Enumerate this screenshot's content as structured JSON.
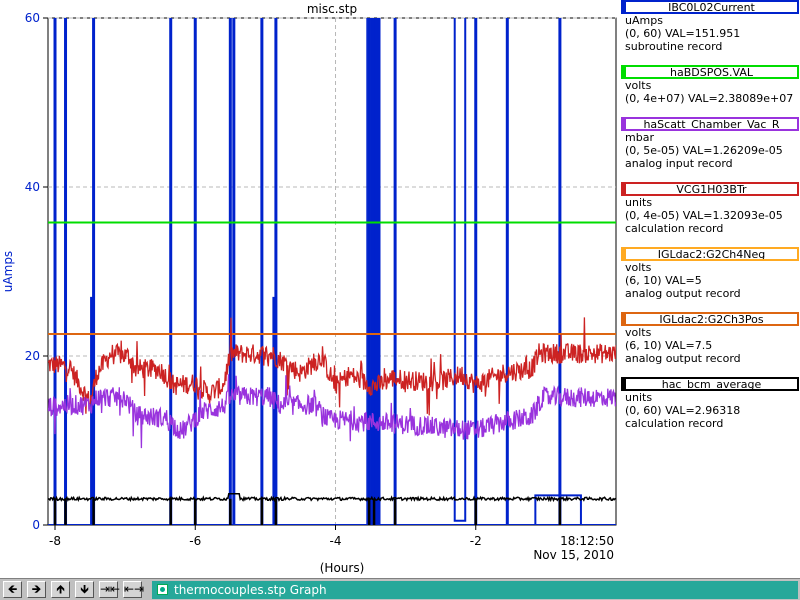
{
  "window": {
    "title": "misc.stp",
    "tab_label": "thermocouples.stp  Graph"
  },
  "toolbar": {
    "buttons": [
      {
        "name": "scroll-left-button",
        "glyph": "🡸"
      },
      {
        "name": "scroll-right-button",
        "glyph": "🡺"
      },
      {
        "name": "scroll-up-button",
        "glyph": "🡹"
      },
      {
        "name": "scroll-down-button",
        "glyph": "🡻"
      },
      {
        "name": "zoom-in-x-button",
        "glyph": "⇥⇤"
      },
      {
        "name": "zoom-out-x-button",
        "glyph": "⇤⇥"
      }
    ]
  },
  "legend": [
    {
      "name": "IBC0L02Current",
      "color": "#0022cc",
      "unit": "uAmps",
      "range": "(0, 60) VAL=151.951",
      "record": "subroutine record"
    },
    {
      "name": "haBDSPOS.VAL",
      "color": "#00dd00",
      "unit": "volts",
      "range": "(0, 4e+07) VAL=2.38089e+07",
      "record": ""
    },
    {
      "name": "haScatt_Chamber_Vac_R",
      "color": "#9933dd",
      "unit": "mbar",
      "range": "(0, 5e-05) VAL=1.26209e-05",
      "record": "analog input record"
    },
    {
      "name": "VCG1H03BTr",
      "color": "#cc2222",
      "unit": "units",
      "range": "(0, 4e-05) VAL=1.32093e-05",
      "record": "calculation record"
    },
    {
      "name": "IGLdac2:G2Ch4Neg",
      "color": "#ffaa22",
      "unit": "volts",
      "range": "(6, 10) VAL=5",
      "record": "analog output record"
    },
    {
      "name": "IGLdac2:G2Ch3Pos",
      "color": "#dd6611",
      "unit": "volts",
      "range": "(6, 10) VAL=7.5",
      "record": "analog output record"
    },
    {
      "name": "hac_bcm_average",
      "color": "#000000",
      "unit": "units",
      "range": "(0, 60) VAL=2.96318",
      "record": "calculation record"
    }
  ],
  "chart_data": {
    "type": "line",
    "title": "misc.stp",
    "xlabel": "(Hours)",
    "ylabel": "uAmps",
    "xlim": [
      -8.1,
      0
    ],
    "ylim": [
      0,
      60
    ],
    "x_ticks": [
      -8,
      -6,
      -4,
      -2
    ],
    "y_ticks": [
      0,
      20,
      40,
      60
    ],
    "end_time_label": "18:12:50",
    "end_date_label": "Nov 15, 2010",
    "grid": true,
    "series": [
      {
        "name": "IBC0L02Current",
        "color": "#0022cc",
        "baseline": 0,
        "spikes_to_top": [
          -8.0,
          -7.85,
          -7.45,
          -6.35,
          -6.0,
          -5.5,
          -5.45,
          -5.05,
          -4.85,
          -3.52,
          -3.45,
          -3.42,
          -3.38,
          -3.15,
          -2.0,
          -1.55,
          -0.8
        ],
        "mid_spikes": [
          {
            "x": -7.45,
            "y": 27
          },
          {
            "x": -4.85,
            "y": 27
          }
        ],
        "gaps": [
          {
            "from": -2.3,
            "to": -2.15
          },
          {
            "from": -1.15,
            "to": -0.5,
            "y": 3.5
          }
        ]
      },
      {
        "name": "haBDSPOS.VAL",
        "color": "#00dd00",
        "constant": 35.8
      },
      {
        "name": "IGLdac2:G2Ch3Pos",
        "color": "#dd6611",
        "constant": 22.6
      },
      {
        "name": "VCG1H03BTr",
        "color": "#cc2222",
        "points": [
          [
            -8.1,
            19
          ],
          [
            -7.8,
            18.8
          ],
          [
            -7.5,
            14.5
          ],
          [
            -7.4,
            18
          ],
          [
            -7.2,
            20.3
          ],
          [
            -6.95,
            20
          ],
          [
            -6.85,
            18.5
          ],
          [
            -6.5,
            18.4
          ],
          [
            -6.3,
            16.5
          ],
          [
            -6.0,
            16.8
          ],
          [
            -5.8,
            15.5
          ],
          [
            -5.6,
            16.5
          ],
          [
            -5.5,
            20.3
          ],
          [
            -4.9,
            20.2
          ],
          [
            -4.8,
            19.6
          ],
          [
            -4.5,
            18.0
          ],
          [
            -4.2,
            19.8
          ],
          [
            -4.0,
            16.5
          ],
          [
            -3.8,
            17.8
          ],
          [
            -3.5,
            16.5
          ],
          [
            -3.4,
            16.5
          ],
          [
            -3.2,
            17.4
          ],
          [
            -2.8,
            17.0
          ],
          [
            -2.5,
            17.0
          ],
          [
            -2.2,
            17.8
          ],
          [
            -2.0,
            16.6
          ],
          [
            -1.6,
            18.0
          ],
          [
            -1.2,
            18.5
          ],
          [
            -1.1,
            20.3
          ],
          [
            0,
            20.3
          ]
        ]
      },
      {
        "name": "haScatt_Chamber_Vac_R",
        "color": "#9933dd",
        "points": [
          [
            -8.1,
            14
          ],
          [
            -7.8,
            14.2
          ],
          [
            -7.5,
            14.2
          ],
          [
            -7.4,
            15.1
          ],
          [
            -7.0,
            15.1
          ],
          [
            -6.85,
            13.0
          ],
          [
            -6.4,
            12.6
          ],
          [
            -6.2,
            11.0
          ],
          [
            -5.9,
            13.4
          ],
          [
            -5.6,
            14.0
          ],
          [
            -5.5,
            15.2
          ],
          [
            -4.95,
            15.2
          ],
          [
            -4.8,
            14.2
          ],
          [
            -4.3,
            14.2
          ],
          [
            -4.1,
            12.4
          ],
          [
            -3.8,
            12.4
          ],
          [
            -3.5,
            12.2
          ],
          [
            -3.2,
            12.0
          ],
          [
            -2.8,
            11.8
          ],
          [
            -2.4,
            11.4
          ],
          [
            -2.0,
            11.2
          ],
          [
            -1.6,
            12.2
          ],
          [
            -1.2,
            12.8
          ],
          [
            -1.05,
            15.1
          ],
          [
            0,
            15.1
          ]
        ]
      },
      {
        "name": "hac_bcm_average",
        "color": "#000000",
        "baseline": 3.1,
        "dropouts": [
          -8.0,
          -7.85,
          -7.45,
          -6.35,
          -6.0,
          -5.5,
          -5.05,
          -4.85,
          -3.52,
          -3.45,
          -3.15,
          -2.0,
          -0.8
        ],
        "bump": {
          "x": -5.45,
          "y": 3.7
        }
      }
    ]
  }
}
